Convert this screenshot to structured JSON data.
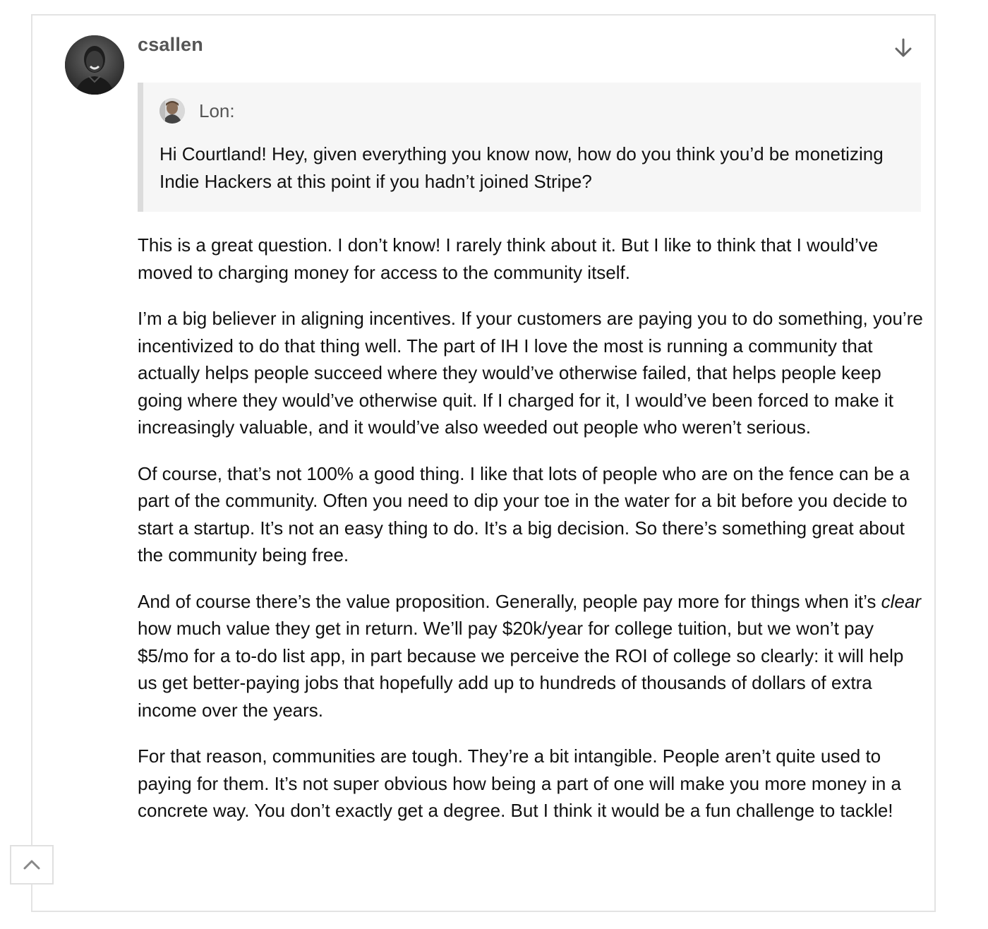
{
  "comment": {
    "author": "csallen",
    "avatar_icon": "avatar-photo",
    "collapse_icon": "arrow-down-icon",
    "quote": {
      "author": "Lon:",
      "text": "Hi Courtland! Hey, given everything you know now, how do you think you’d be monetizing Indie Hackers at this point if you hadn’t joined Stripe?"
    },
    "paragraphs": [
      "This is a great question. I don’t know! I rarely think about it. But I like to think that I would’ve moved to charging money for access to the community itself.",
      "I’m a big believer in aligning incentives. If your customers are paying you to do something, you’re incentivized to do that thing well. The part of IH I love the most is running a community that actually helps people succeed where they would’ve otherwise failed, that helps people keep going where they would’ve otherwise quit. If I charged for it, I would’ve been forced to make it increasingly valuable, and it would’ve also weeded out people who weren’t serious.",
      "Of course, that’s not 100% a good thing. I like that lots of people who are on the fence can be a part of the community. Often you need to dip your toe in the water for a bit before you decide to start a startup. It’s not an easy thing to do. It’s a big decision. So there’s something great about the community being free.",
      {
        "italic_word": "clear",
        "before": "And of course there’s the value proposition. Generally, people pay more for things when it’s",
        "after": "how much value they get in return. We’ll pay $20k/year for college tuition, but we won’t pay $5/mo for a to-do list app, in part because we perceive the ROI of college so clearly: it will help us get better-paying jobs that hopefully add up to hundreds of thousands of dollars of extra income over the years."
      },
      "For that reason, communities are tough. They’re a bit intangible. People aren’t quite used to paying for them. It’s not super obvious how being a part of one will make you more money in a concrete way. You don’t exactly get a degree. But I think it would be a fun challenge to tackle!"
    ]
  },
  "scroll_top_icon": "chevron-up-icon"
}
